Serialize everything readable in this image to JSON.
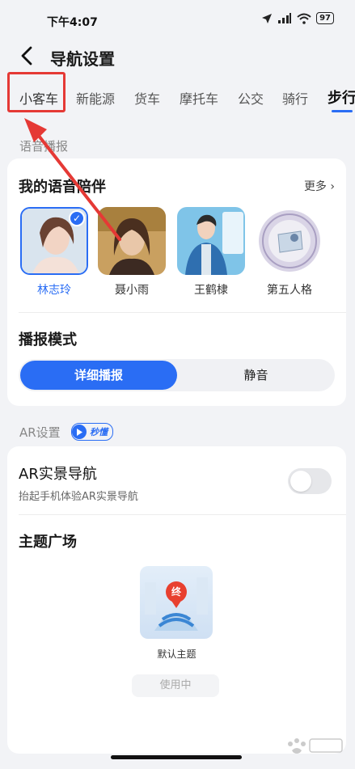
{
  "status": {
    "time": "下午4:07",
    "battery": "97"
  },
  "header": {
    "title": "导航设置"
  },
  "tabs": [
    {
      "label": "小客车"
    },
    {
      "label": "新能源"
    },
    {
      "label": "货车"
    },
    {
      "label": "摩托车"
    },
    {
      "label": "公交"
    },
    {
      "label": "骑行"
    },
    {
      "label": "步行"
    }
  ],
  "voice_section": {
    "label": "语音播报",
    "card_title": "我的语音陪伴",
    "more": "更多",
    "voices": [
      {
        "name": "林志玲",
        "selected": true
      },
      {
        "name": "聂小雨",
        "selected": false
      },
      {
        "name": "王鹤棣",
        "selected": false
      },
      {
        "name": "第五人格",
        "selected": false
      }
    ],
    "mode_title": "播报模式",
    "mode_options": [
      "详细播报",
      "静音"
    ]
  },
  "ar_section": {
    "label": "AR设置",
    "badge": "秒懂",
    "ar_nav_title": "AR实景导航",
    "ar_nav_sub": "抬起手机体验AR实景导航",
    "ar_nav_enabled": false,
    "theme_title": "主题广场",
    "theme_pin": "终",
    "theme_name": "默认主题",
    "theme_button": "使用中"
  },
  "colors": {
    "accent": "#2a6df4",
    "annotation": "#e53935"
  }
}
